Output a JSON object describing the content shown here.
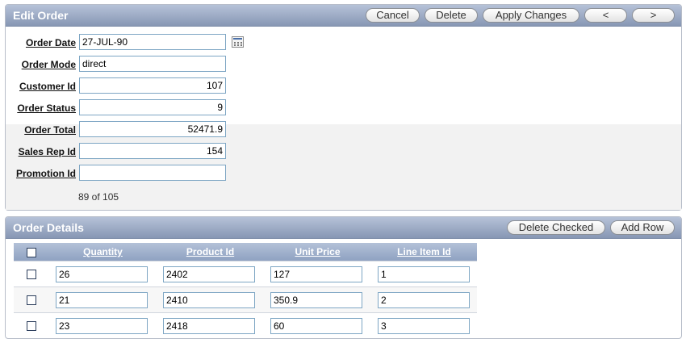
{
  "edit_order": {
    "title": "Edit Order",
    "buttons": {
      "cancel": "Cancel",
      "delete": "Delete",
      "apply": "Apply Changes",
      "prev": "<",
      "next": ">"
    },
    "fields": {
      "order_date": {
        "label": "Order Date",
        "value": "27-JUL-90"
      },
      "order_mode": {
        "label": "Order Mode",
        "value": "direct"
      },
      "customer_id": {
        "label": "Customer Id",
        "value": "107"
      },
      "order_status": {
        "label": "Order Status",
        "value": "9"
      },
      "order_total": {
        "label": "Order Total",
        "value": "52471.9"
      },
      "sales_rep_id": {
        "label": "Sales Rep Id",
        "value": "154"
      },
      "promotion_id": {
        "label": "Promotion Id",
        "value": ""
      }
    },
    "pager": "89 of 105",
    "calendar_icon": "calendar-icon"
  },
  "order_details": {
    "title": "Order Details",
    "buttons": {
      "delete_checked": "Delete Checked",
      "add_row": "Add Row"
    },
    "columns": [
      "Quantity",
      "Product Id",
      "Unit Price",
      "Line Item Id"
    ],
    "rows": [
      {
        "quantity": "26",
        "product_id": "2402",
        "unit_price": "127",
        "line_item_id": "1"
      },
      {
        "quantity": "21",
        "product_id": "2410",
        "unit_price": "350.9",
        "line_item_id": "2"
      },
      {
        "quantity": "23",
        "product_id": "2418",
        "unit_price": "60",
        "line_item_id": "3"
      }
    ]
  },
  "colors": {
    "header_top": "#b6c2d8",
    "header_bottom": "#8797b4",
    "input_border": "#7ea6c4"
  }
}
